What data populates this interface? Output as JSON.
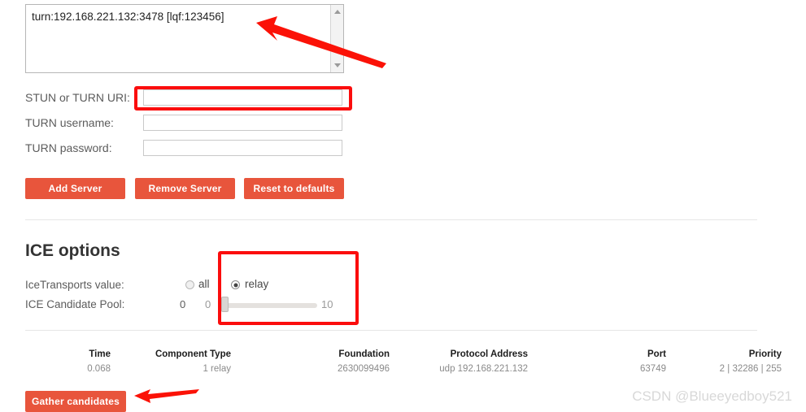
{
  "server_list": {
    "value": "turn:192.168.221.132:3478 [lqf:123456]",
    "scroll_up_icon": "triangle-up-icon",
    "scroll_down_icon": "triangle-down-icon"
  },
  "form": {
    "uri": {
      "label": "STUN or TURN URI:",
      "value": "",
      "placeholder": ""
    },
    "username": {
      "label": "TURN username:",
      "value": "",
      "placeholder": ""
    },
    "password": {
      "label": "TURN password:",
      "value": "",
      "placeholder": ""
    }
  },
  "buttons": {
    "add_server": "Add Server",
    "remove_server": "Remove Server",
    "reset_defaults": "Reset to defaults",
    "gather_candidates": "Gather candidates",
    "color": "#e8553c"
  },
  "ice_options": {
    "heading": "ICE options",
    "transports_label": "IceTransports value:",
    "transports": [
      {
        "label": "all",
        "selected": false
      },
      {
        "label": "relay",
        "selected": true
      }
    ],
    "pool_label": "ICE Candidate Pool:",
    "pool_value": "0",
    "pool_min": "0",
    "pool_max": "10"
  },
  "candidates_table": {
    "headers": [
      "Time",
      "Component Type",
      "Foundation",
      "Protocol Address",
      "Port",
      "Priority"
    ],
    "rows": [
      {
        "time": "0.068",
        "component_type": "1 relay",
        "foundation": "2630099496",
        "protocol_address": "udp 192.168.221.132",
        "port": "63749",
        "priority": "2 | 32286 | 255"
      }
    ]
  },
  "watermark": "CSDN @Blueeyedboy521",
  "annotations": {
    "highlight_color": "#fb0d0d",
    "boxes": [
      "stun-turn-uri-input",
      "ice-options-controls"
    ],
    "arrows": [
      "arrow-to-server-list",
      "arrow-to-gather-button"
    ]
  }
}
